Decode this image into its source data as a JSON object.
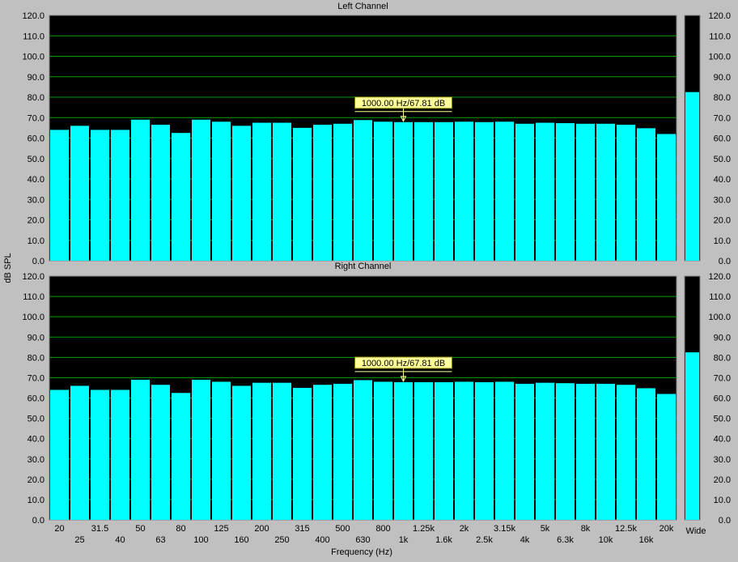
{
  "colors": {
    "background": "#c0c0c0",
    "plot_background": "#000000",
    "bar_fill": "#00ffff",
    "grid": "#00a000",
    "marker_fill": "#ffff99",
    "marker_border": "#808000"
  },
  "y_axis_label": "dB SPL",
  "x_axis_label": "Frequency (Hz)",
  "wide_label": "Wide",
  "chart_data": [
    {
      "type": "bar",
      "title": "Left Channel",
      "ylim": [
        0,
        120
      ],
      "yticks": [
        "0.0",
        "10.0",
        "20.0",
        "30.0",
        "40.0",
        "50.0",
        "60.0",
        "70.0",
        "80.0",
        "90.0",
        "100.0",
        "110.0",
        "120.0"
      ],
      "grid": true,
      "categories": [
        "20",
        "25",
        "31.5",
        "40",
        "50",
        "63",
        "80",
        "100",
        "125",
        "160",
        "200",
        "250",
        "315",
        "400",
        "500",
        "630",
        "800",
        "1k",
        "1.25k",
        "1.6k",
        "2k",
        "2.5k",
        "3.15k",
        "4k",
        "5k",
        "6.3k",
        "8k",
        "10k",
        "12.5k",
        "16k",
        "20k"
      ],
      "values": [
        64,
        66,
        64,
        64,
        69,
        66.5,
        62.5,
        69,
        68,
        66,
        67.5,
        67.5,
        65,
        66.5,
        67,
        68.8,
        68,
        67.81,
        67.8,
        67.8,
        68,
        67.8,
        68,
        67,
        67.5,
        67.3,
        67,
        67,
        66.5,
        64.8,
        62
      ],
      "marker": {
        "label": "1000.00 Hz/67.81 dB",
        "category": "1k",
        "value": 67.81
      },
      "wide": {
        "value": 82.5,
        "label": "Wide"
      }
    },
    {
      "type": "bar",
      "title": "Right Channel",
      "ylim": [
        0,
        120
      ],
      "yticks": [
        "0.0",
        "10.0",
        "20.0",
        "30.0",
        "40.0",
        "50.0",
        "60.0",
        "70.0",
        "80.0",
        "90.0",
        "100.0",
        "110.0",
        "120.0"
      ],
      "grid": true,
      "categories": [
        "20",
        "25",
        "31.5",
        "40",
        "50",
        "63",
        "80",
        "100",
        "125",
        "160",
        "200",
        "250",
        "315",
        "400",
        "500",
        "630",
        "800",
        "1k",
        "1.25k",
        "1.6k",
        "2k",
        "2.5k",
        "3.15k",
        "4k",
        "5k",
        "6.3k",
        "8k",
        "10k",
        "12.5k",
        "16k",
        "20k"
      ],
      "values": [
        64,
        66,
        64,
        64,
        69,
        66.5,
        62.5,
        69,
        68,
        66,
        67.5,
        67.5,
        65,
        66.5,
        67,
        68.8,
        68,
        67.81,
        67.8,
        67.8,
        68,
        67.8,
        68,
        67,
        67.5,
        67.3,
        67,
        67,
        66.5,
        64.8,
        62
      ],
      "marker": {
        "label": "1000.00 Hz/67.81 dB",
        "category": "1k",
        "value": 67.81
      },
      "wide": {
        "value": 82.5,
        "label": "Wide"
      }
    }
  ]
}
